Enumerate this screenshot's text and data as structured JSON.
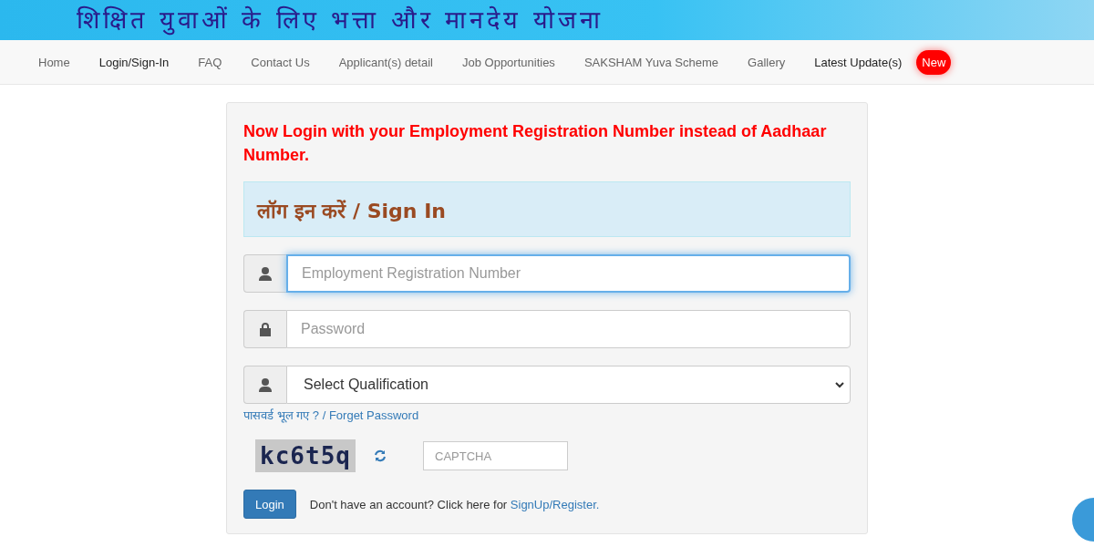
{
  "banner": {
    "title": "शिक्षित युवाओं के लिए भत्ता और मानदेय योजना"
  },
  "nav": [
    {
      "label": "Home",
      "highlighted": false
    },
    {
      "label": "Login/Sign-In",
      "highlighted": true
    },
    {
      "label": "FAQ",
      "highlighted": false
    },
    {
      "label": "Contact Us",
      "highlighted": false
    },
    {
      "label": "Applicant(s) detail",
      "highlighted": false
    },
    {
      "label": "Job Opportunities",
      "highlighted": false
    },
    {
      "label": "SAKSHAM Yuva Scheme",
      "highlighted": false
    },
    {
      "label": "Gallery",
      "highlighted": false
    },
    {
      "label": "Latest Update(s)",
      "highlighted": true,
      "badge": "New"
    }
  ],
  "notice": "Now Login with your Employment Registration Number instead of Aadhaar Number.",
  "panel_title": "लॉग इन करें / Sign In",
  "fields": [
    {
      "kind": "text",
      "placeholder": "Employment Registration Number",
      "focused": true
    },
    {
      "kind": "password",
      "placeholder": "Password",
      "focused": false
    },
    {
      "kind": "select",
      "value": "Select Qualification"
    }
  ],
  "forgot_link": "पासवर्ड भूल गए ? / Forget Password",
  "captcha": {
    "code": "kc6t5q",
    "placeholder": "CAPTCHA"
  },
  "login_button": "Login",
  "signup_text": "Don't have an account? Click here for",
  "signup_link": "SignUp/Register."
}
